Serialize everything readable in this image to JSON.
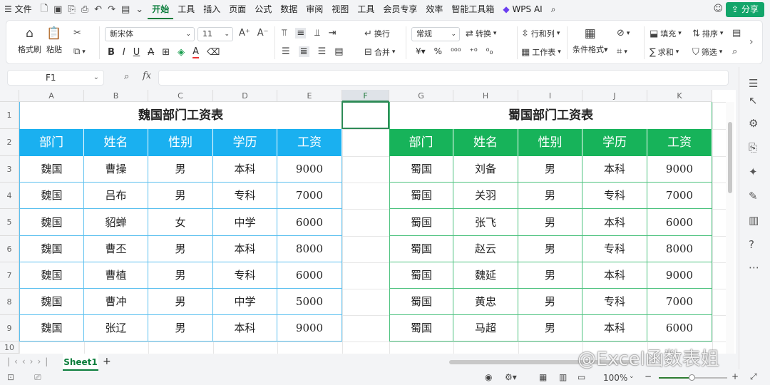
{
  "menu": {
    "items": [
      "文件",
      "开始",
      "工具",
      "插入",
      "页面",
      "公式",
      "数据",
      "审阅",
      "视图",
      "工具",
      "会员专享",
      "效率",
      "智能工具箱"
    ],
    "wps_ai": "WPS AI",
    "share": "分享"
  },
  "ribbon": {
    "format_painter": "格式刷",
    "paste": "粘贴",
    "font_name": "新宋体",
    "font_size": "11",
    "wrap": "换行",
    "merge": "合并",
    "number_format": "常规",
    "convert": "转换",
    "row_col": "行和列",
    "worksheet": "工作表",
    "cond_format": "条件格式",
    "fill": "填充",
    "sort": "排序",
    "sum": "求和",
    "filter": "筛选"
  },
  "formula_bar": {
    "name_box": "F1",
    "fx": "fx"
  },
  "columns": [
    "A",
    "B",
    "C",
    "D",
    "E",
    "F",
    "G",
    "H",
    "I",
    "J",
    "K"
  ],
  "rows": [
    "1",
    "2",
    "3",
    "4",
    "5",
    "6",
    "7",
    "8",
    "9",
    "10"
  ],
  "wei_table": {
    "title": "魏国部门工资表",
    "headers": [
      "部门",
      "姓名",
      "性别",
      "学历",
      "工资"
    ],
    "rows": [
      [
        "魏国",
        "曹操",
        "男",
        "本科",
        "9000"
      ],
      [
        "魏国",
        "吕布",
        "男",
        "专科",
        "7000"
      ],
      [
        "魏国",
        "貂蝉",
        "女",
        "中学",
        "6000"
      ],
      [
        "魏国",
        "曹丕",
        "男",
        "本科",
        "8000"
      ],
      [
        "魏国",
        "曹植",
        "男",
        "专科",
        "6000"
      ],
      [
        "魏国",
        "曹冲",
        "男",
        "中学",
        "5000"
      ],
      [
        "魏国",
        "张辽",
        "男",
        "本科",
        "9000"
      ]
    ]
  },
  "shu_table": {
    "title": "蜀国部门工资表",
    "headers": [
      "部门",
      "姓名",
      "性别",
      "学历",
      "工资"
    ],
    "rows": [
      [
        "蜀国",
        "刘备",
        "男",
        "本科",
        "9000"
      ],
      [
        "蜀国",
        "关羽",
        "男",
        "专科",
        "7000"
      ],
      [
        "蜀国",
        "张飞",
        "男",
        "本科",
        "6000"
      ],
      [
        "蜀国",
        "赵云",
        "男",
        "专科",
        "8000"
      ],
      [
        "蜀国",
        "魏延",
        "男",
        "本科",
        "9000"
      ],
      [
        "蜀国",
        "黄忠",
        "男",
        "专科",
        "7000"
      ],
      [
        "蜀国",
        "马超",
        "男",
        "本科",
        "6000"
      ]
    ]
  },
  "sheet_tab": "Sheet1",
  "status": {
    "zoom": "100%"
  },
  "watermark": "@Excel函数表姐",
  "colors": {
    "wei_header": "#1ab0f0",
    "shu_header": "#17b35a",
    "accent": "#0a7d3b"
  }
}
